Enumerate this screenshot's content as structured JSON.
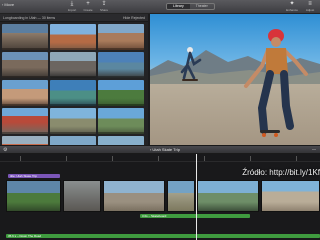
{
  "toolbar": {
    "back_label": "Move",
    "import_label": "Import",
    "create_label": "Create",
    "share_label": "Share",
    "tabs": [
      {
        "label": "Library",
        "active": true
      },
      {
        "label": "Theater",
        "active": false
      }
    ],
    "enhance_label": "Enhance",
    "adjust_label": "Adjust"
  },
  "browser": {
    "header_left": "Longboarding in Utah — 30 items",
    "header_right": "Hide Rejected"
  },
  "divider": {
    "project_title": "Utah Skate Trip"
  },
  "timeline": {
    "top_bar_label": "title: Utah Skate Trip",
    "middle_bar_label": "3.0s – Skateboard",
    "bottom_bar_label": "35.6 s – Down The Road"
  },
  "watermark": "Źródło: http://bit.ly/1Kf",
  "colors": {
    "accent": "#e8e8e8",
    "bar_purple": "#7b56b8",
    "bar_green": "#3f9b3f",
    "background": "#1c1c1e"
  }
}
